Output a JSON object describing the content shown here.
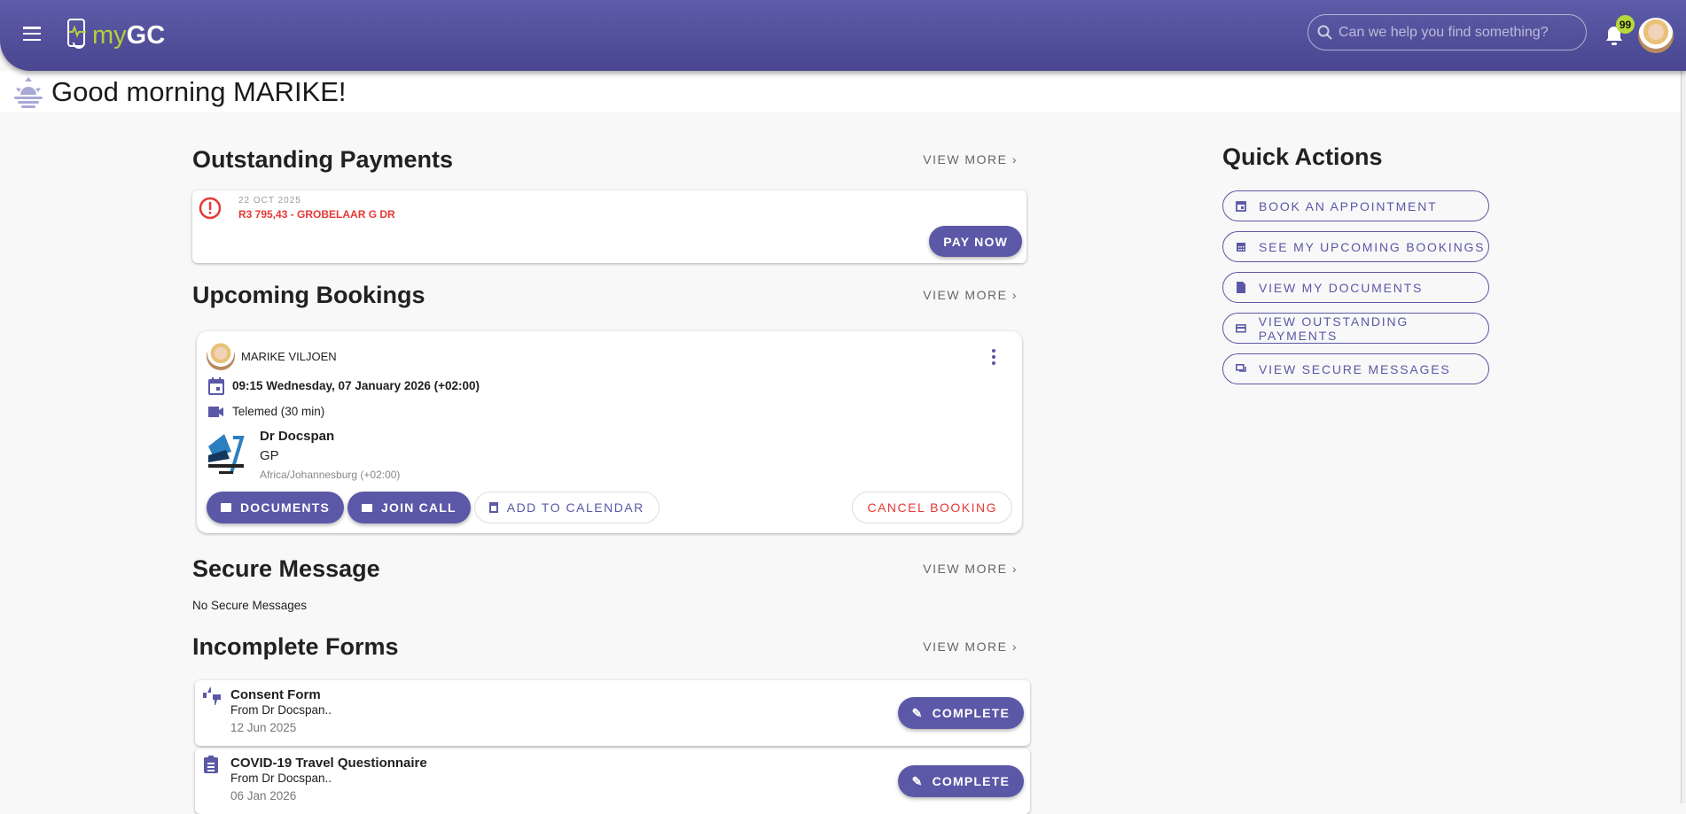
{
  "header": {
    "logo_my": "my",
    "logo_gc": "GC",
    "search_placeholder": "Can we help you find something?",
    "notification_count": "99"
  },
  "greeting": "Good morning MARIKE!",
  "view_more": "VIEW MORE",
  "outstanding": {
    "title": "Outstanding Payments",
    "date": "22 OCT 2025",
    "amount": "R3 795,43 - GROBELAAR G DR",
    "pay_label": "PAY NOW"
  },
  "bookings": {
    "title": "Upcoming Bookings",
    "patient": "MARIKE VILJOEN",
    "datetime": "09:15 Wednesday, 07 January 2026 (+02:00)",
    "type": "Telemed (30 min)",
    "doctor": "Dr Docspan",
    "specialty": "GP",
    "timezone": "Africa/Johannesburg (+02:00)",
    "documents_label": "DOCUMENTS",
    "join_label": "JOIN CALL",
    "calendar_label": "ADD TO CALENDAR",
    "cancel_label": "CANCEL BOOKING"
  },
  "messages": {
    "title": "Secure Message",
    "empty": "No Secure Messages"
  },
  "forms": {
    "title": "Incomplete Forms",
    "complete_label": "COMPLETE",
    "items": [
      {
        "title": "Consent Form",
        "from": "From Dr Docspan..",
        "date": "12 Jun 2025"
      },
      {
        "title": "COVID-19 Travel Questionnaire",
        "from": "From Dr Docspan..",
        "date": "06 Jan 2026"
      }
    ]
  },
  "quick_actions": {
    "title": "Quick Actions",
    "items": [
      "BOOK AN APPOINTMENT",
      "SEE MY UPCOMING BOOKINGS",
      "VIEW MY DOCUMENTS",
      "VIEW OUTSTANDING PAYMENTS",
      "VIEW SECURE MESSAGES"
    ]
  },
  "colors": {
    "primary": "#5b58a7",
    "accent": "#b5cf3a",
    "danger": "#e53935"
  }
}
